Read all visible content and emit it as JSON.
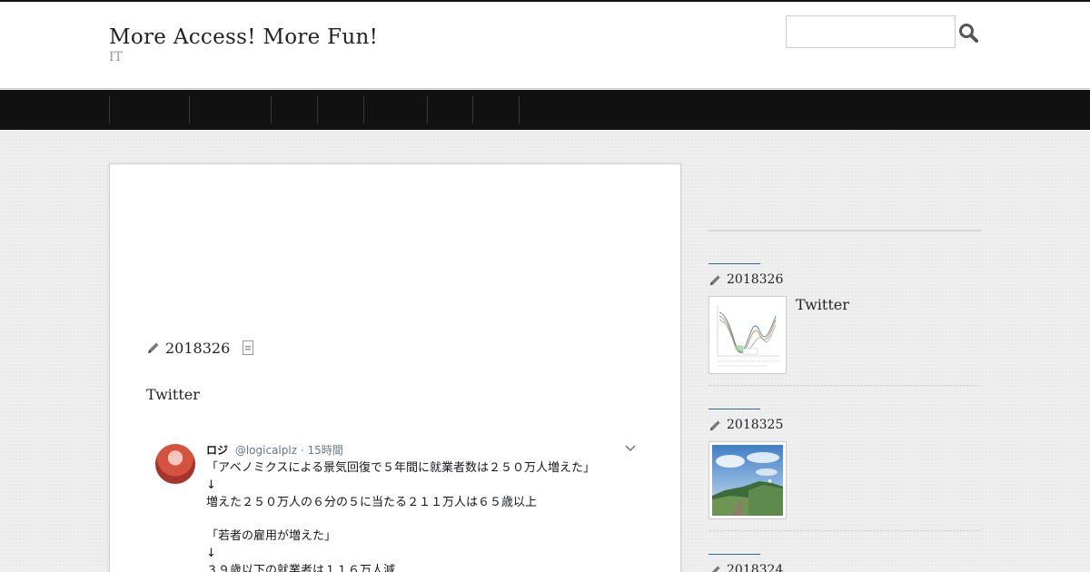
{
  "header": {
    "site_title": "More Access! More Fun!",
    "site_description": "IT",
    "search": {
      "placeholder": "",
      "button_icon": "search-icon"
    }
  },
  "nav": {
    "items": [
      "",
      "",
      "",
      "",
      "",
      "",
      ""
    ]
  },
  "post": {
    "date": "2018326",
    "date_icon": "pencil-icon",
    "category_icon": "document-icon",
    "text": "Twitter",
    "tweet": {
      "author": "ロジ",
      "handle": "@logicalplz",
      "time": "· 15時間",
      "lines": [
        "「アベノミクスによる景気回復で５年間に就業者数は２５０万人増えた」",
        "↓",
        "増えた２５０万人の６分の５に当たる２１１万人は６５歳以上",
        "",
        "「若者の雇用が増えた」",
        "↓",
        "３９歳以下の就業者は１１６万人減"
      ]
    }
  },
  "sidebar": {
    "entries": [
      {
        "date": "2018326",
        "title": "Twitter",
        "thumb": "chart-thumbnail"
      },
      {
        "date": "2018325",
        "title": "",
        "thumb": "landscape-thumbnail"
      },
      {
        "date": "2018324",
        "title": "",
        "thumb": ""
      }
    ]
  },
  "colors": {
    "nav_bg": "#111111",
    "accent": "#2a6bb0"
  }
}
